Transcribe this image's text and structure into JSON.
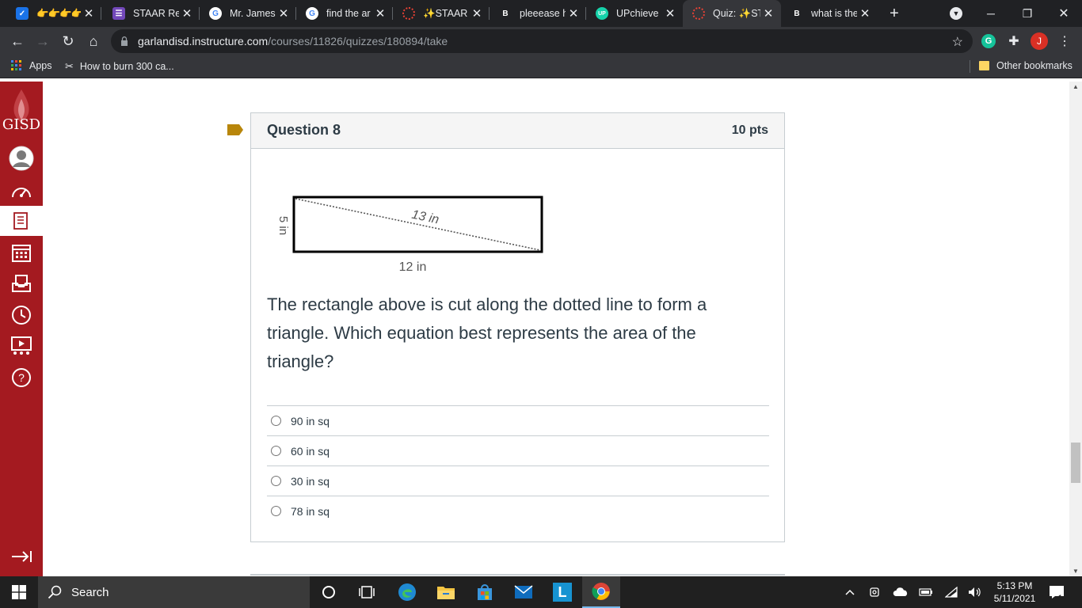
{
  "browser": {
    "tabs": [
      {
        "title": "",
        "favicon": "extension-stars",
        "active": false
      },
      {
        "title": "STAAR Rev",
        "favicon": "purple-list",
        "active": false
      },
      {
        "title": "Mr. James",
        "favicon": "google-g",
        "active": false
      },
      {
        "title": "find the ar",
        "favicon": "google-g",
        "active": false
      },
      {
        "title": "✨STAAR",
        "favicon": "canvas-ring",
        "active": false
      },
      {
        "title": "pleeease h",
        "favicon": "brainly-b",
        "active": false
      },
      {
        "title": "UPchieve",
        "favicon": "upchieve-up",
        "active": false
      },
      {
        "title": "Quiz: ✨ST",
        "favicon": "canvas-ring",
        "active": true
      },
      {
        "title": "what is the",
        "favicon": "brainly-b",
        "active": false
      }
    ],
    "url_host": "garlandisd.instructure.com",
    "url_path": "/courses/11826/quizzes/180894/take",
    "profile_initial": "J",
    "bookmarks": {
      "apps_label": "Apps",
      "item_label": "How to burn 300 ca...",
      "other_label": "Other bookmarks"
    }
  },
  "sidebar": {
    "logo_text": "GISD",
    "items": [
      "account-icon",
      "dashboard-icon",
      "courses-icon",
      "calendar-icon",
      "inbox-icon",
      "history-icon",
      "studio-icon",
      "help-icon"
    ],
    "collapse_icon": "collapse-arrow-icon"
  },
  "question": {
    "title": "Question 8",
    "points": "10 pts",
    "figure": {
      "side_label": "5 in",
      "diagonal_label": "13 in",
      "bottom_label": "12 in"
    },
    "text": "The rectangle above is cut along the dotted line to form a triangle.  Which equation best represents the area of the triangle?",
    "answers": [
      "90 in sq",
      "60 in sq",
      "30 in sq",
      "78 in sq"
    ]
  },
  "taskbar": {
    "search_label": "Search",
    "time": "5:13 PM",
    "date": "5/11/2021",
    "notification_count": "1"
  },
  "colors": {
    "sidebar": "#a41a20",
    "flag": "#b8860b",
    "chrome_dark": "#202124",
    "chrome_toolbar": "#35363a"
  }
}
